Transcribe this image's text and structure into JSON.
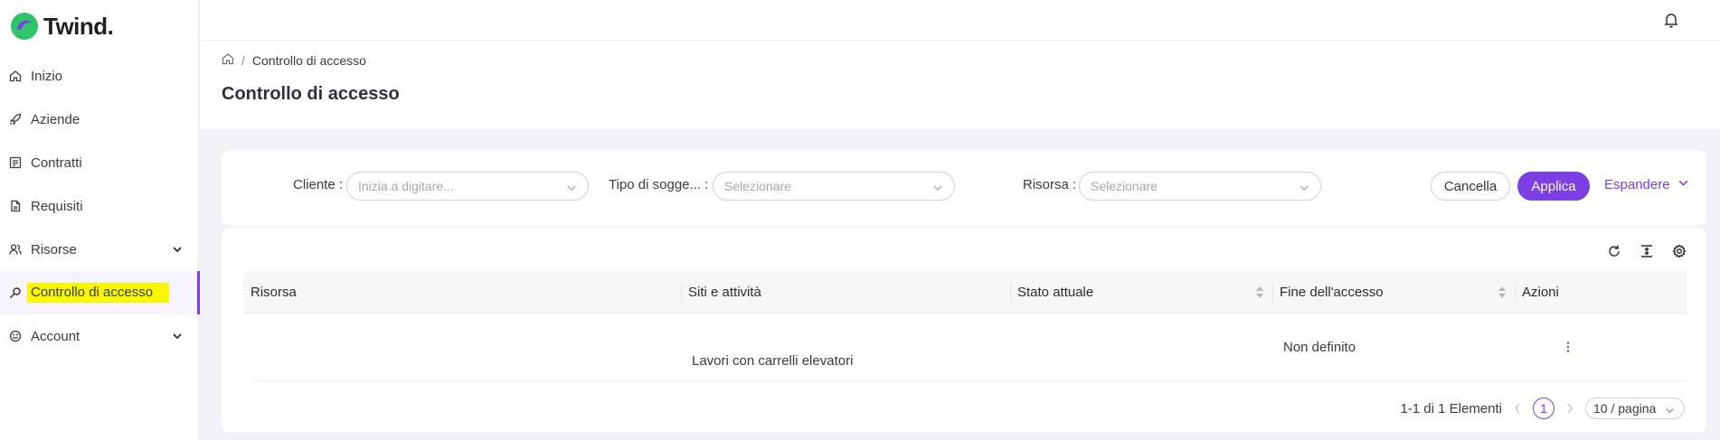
{
  "brand": {
    "name": "Twind.",
    "colors": {
      "accent": "#7b3fe4",
      "logo_green": "#2fc46b",
      "logo_purple": "#7b3fe4"
    }
  },
  "sidebar": {
    "items": [
      {
        "label": "Inizio",
        "icon": "home-icon"
      },
      {
        "label": "Aziende",
        "icon": "rocket-icon"
      },
      {
        "label": "Contratti",
        "icon": "contract-icon"
      },
      {
        "label": "Requisiti",
        "icon": "file-icon"
      },
      {
        "label": "Risorse",
        "icon": "users-icon",
        "expandable": true
      },
      {
        "label": "Controllo di accesso",
        "icon": "key-icon",
        "active": true
      },
      {
        "label": "Account",
        "icon": "smile-icon",
        "expandable": true
      }
    ]
  },
  "breadcrumb": {
    "current": "Controllo di accesso",
    "separator": "/"
  },
  "page": {
    "title": "Controllo di accesso"
  },
  "filters": {
    "cliente": {
      "label": "Cliente",
      "placeholder": "Inizia a digitare..."
    },
    "tipo": {
      "label": "Tipo di sogge...",
      "placeholder": "Selezionare"
    },
    "risorsa": {
      "label": "Risorsa",
      "placeholder": "Selezionare"
    },
    "cancel_label": "Cancella",
    "apply_label": "Applica",
    "expand_label": "Espandere"
  },
  "table": {
    "columns": [
      "Risorsa",
      "Siti e attività",
      "Stato attuale",
      "Fine dell'accesso",
      "Azioni"
    ],
    "rows": [
      {
        "risorsa": "",
        "siti": "Lavori con carrelli elevatori",
        "stato": "",
        "fine": "Non definito"
      }
    ]
  },
  "pagination": {
    "summary": "1-1 di 1 Elementi",
    "current_page": "1",
    "page_size": "10 / pagina"
  }
}
